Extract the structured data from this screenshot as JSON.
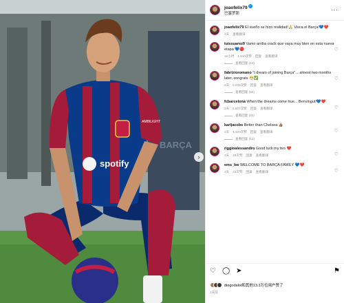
{
  "post": {
    "author": "joaofelix79",
    "author_subtitle": "巴塞罗那",
    "more_icon": "more-horizontal-icon",
    "photo": {
      "chest_logo": "spotify",
      "sleeve_text": "AMBILIGHT",
      "background_text": "BARÇA"
    }
  },
  "comments": [
    {
      "user": "joaofelix79",
      "text": "El sueño se hizo realidad!🙏 Visca el Barça!💙❤️",
      "meta": [
        "2天",
        "查看翻译"
      ],
      "replies": "",
      "has_heart": false
    },
    {
      "user": "luissuarez9",
      "text": "Vamo arriba crack que vaya muy bien en esta nueva etapa 💙🔴",
      "meta": [
        "12小时",
        "1,910次赞",
        "回复",
        "查看翻译"
      ],
      "replies": "查看回复 (44)",
      "has_heart": true
    },
    {
      "user": "fabrizioromano",
      "text": "\"I dream of joining Barça\"... almost two months later, congrats 😁✅",
      "meta": [
        "2天",
        "6,938次赞",
        "回复",
        "查看翻译"
      ],
      "replies": "查看回复 (50)",
      "has_heart": true
    },
    {
      "user": "fcbarcelona",
      "text": "When the dreams come true... Benvingut!💙❤️",
      "meta": [
        "2天",
        "5,807次赞",
        "回复",
        "查看翻译"
      ],
      "replies": "查看回复 (34)",
      "has_heart": true
    },
    {
      "user": "karljacobs",
      "text": "Better than Chelsea 👍🏽",
      "meta": [
        "2天",
        "1,420次赞",
        "回复",
        "查看翻译"
      ],
      "replies": "查看回复 (53)",
      "has_heart": true
    },
    {
      "user": "riggioalessandro",
      "text": "Good luck my bro ❤️",
      "meta": [
        "2天",
        "19次赞",
        "回复",
        "查看翻译"
      ],
      "replies": "",
      "has_heart": true
    },
    {
      "user": "ems_kw",
      "text": "WELCOME TO BARÇA FAMILY 💙❤️",
      "meta": [
        "2天",
        "33次赞",
        "回复",
        "查看翻译"
      ],
      "replies": "",
      "has_heart": true
    }
  ],
  "actions": {
    "like_icon": "heart-icon",
    "comment_icon": "comment-icon",
    "share_icon": "send-icon",
    "save_icon": "bookmark-icon"
  },
  "likes_text": "diogodalot和其他13.3万位用户赞了",
  "date": "2天前"
}
